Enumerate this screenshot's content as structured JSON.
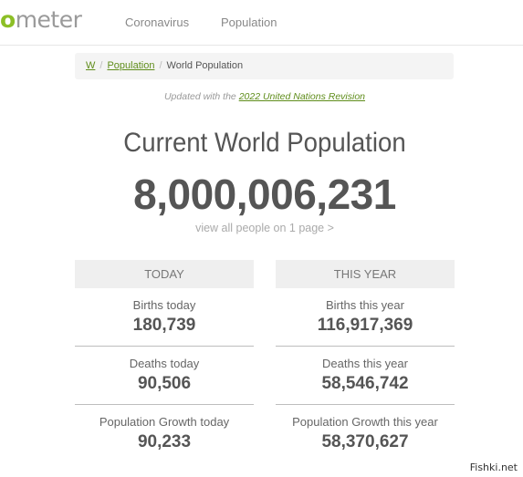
{
  "header": {
    "logo_prefix": "o",
    "logo_rest": "meter",
    "nav": [
      "Coronavirus",
      "Population"
    ]
  },
  "breadcrumb": {
    "home": "W",
    "section": "Population",
    "current": "World Population",
    "separator": "/"
  },
  "updated": {
    "prefix": "Updated with the ",
    "link": "2022 United Nations Revision"
  },
  "main": {
    "title": "Current World Population",
    "count": "8,000,006,231",
    "view_all": "view all people on 1 page >"
  },
  "today": {
    "header": "TODAY",
    "stats": [
      {
        "label": "Births today",
        "value": "180,739"
      },
      {
        "label": "Deaths today",
        "value": "90,506"
      },
      {
        "label": "Population Growth today",
        "value": "90,233"
      }
    ]
  },
  "this_year": {
    "header": "THIS YEAR",
    "stats": [
      {
        "label": "Births this year",
        "value": "116,917,369"
      },
      {
        "label": "Deaths this year",
        "value": "58,546,742"
      },
      {
        "label": "Population Growth this year",
        "value": "58,370,627"
      }
    ]
  },
  "watermark": "Fishki.net"
}
